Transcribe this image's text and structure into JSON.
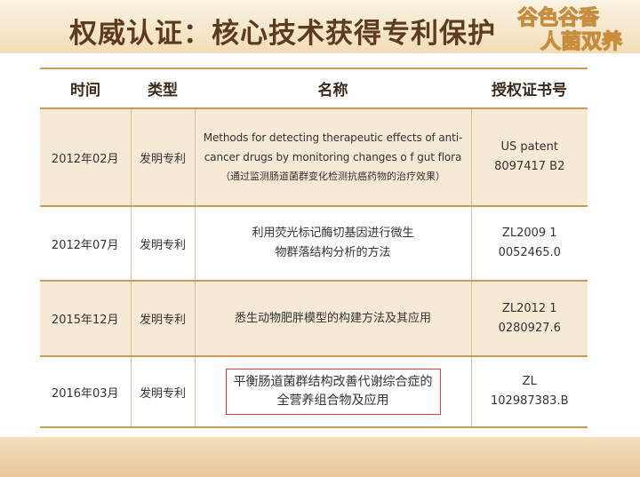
{
  "slide": {
    "title": "权威认证：核心技术获得专利保护",
    "logo_text": [
      "谷色谷香",
      "人菌双养"
    ]
  },
  "table": {
    "headers": [
      "时间",
      "类型",
      "名称",
      "授权证书号"
    ],
    "rows": [
      {
        "date": "2012年02月",
        "type": "发明专利",
        "name_lines": [
          "Methods for detecting therapeutic effects of anti-",
          "cancer drugs by monitoring changes o f gut flora",
          "（通过监测肠道菌群变化检测抗癌药物的治疗效果）"
        ],
        "grant_lines": [
          "US patent",
          "8097417 B2"
        ]
      },
      {
        "date": "2012年07月",
        "type": "发明专利",
        "name_lines": [
          "利用荧光标记酶切基因进行微生",
          "物群落结构分析的方法"
        ],
        "grant_lines": [
          "ZL2009 1",
          "0052465.0"
        ]
      },
      {
        "date": "2015年12月",
        "type": "发明专利",
        "name_lines": [
          "悉生动物肥胖模型的构建方法及其应用"
        ],
        "grant_lines": [
          "ZL2012 1",
          "0280927.6"
        ]
      },
      {
        "date": "2016年03月",
        "type": "发明专利",
        "name_lines": [
          "平衡肠道菌群结构改善代谢综合症的",
          "全营养组合物及应用"
        ],
        "grant_lines": [
          "ZL",
          "102987383.B"
        ]
      }
    ]
  },
  "colors": {
    "title": "#5e3a1e",
    "rule": "#c99a5a",
    "row_shade": "#f6ead6",
    "highlight_border": "#e23a3a",
    "logo_text": "#ffffff",
    "logo_outline": "#c78d3c"
  }
}
